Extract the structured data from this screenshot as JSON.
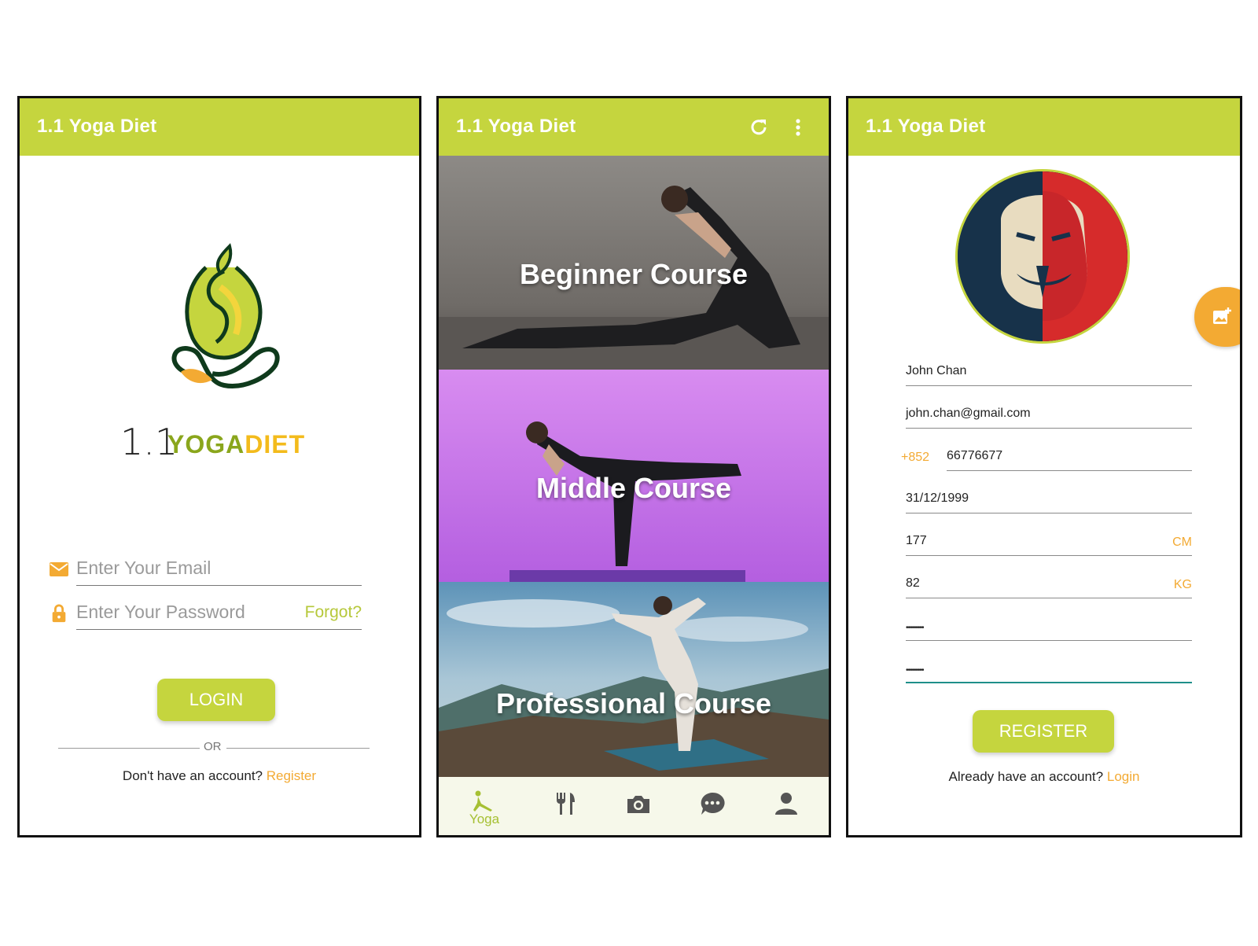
{
  "app": {
    "title": "1.1 Yoga Diet"
  },
  "login": {
    "logo": {
      "number": "1.1",
      "word_yoga": "YOGA",
      "word_diet": "DIET"
    },
    "email": {
      "placeholder": "Enter Your Email",
      "icon": "mail-icon"
    },
    "password": {
      "placeholder": "Enter Your Password",
      "icon": "lock-icon"
    },
    "forgot_label": "Forgot?",
    "login_label": "LOGIN",
    "or_label": "OR",
    "no_account_text": "Don't have an account?",
    "register_link": "Register"
  },
  "courses": {
    "actions": {
      "refresh_icon": "refresh-icon",
      "menu_icon": "more-vert-icon"
    },
    "items": [
      {
        "label": "Beginner Course"
      },
      {
        "label": "Middle Course"
      },
      {
        "label": "Professional Course"
      }
    ],
    "nav": [
      {
        "icon": "yoga-icon",
        "label": "Yoga",
        "active": true
      },
      {
        "icon": "restaurant-icon"
      },
      {
        "icon": "camera-icon"
      },
      {
        "icon": "chat-icon"
      },
      {
        "icon": "person-icon"
      }
    ]
  },
  "register": {
    "fab_icon": "add-photo-icon",
    "name": "John Chan",
    "email": "john.chan@gmail.com",
    "phone_prefix": "+852",
    "phone": "66776677",
    "birthday": "31/12/1999",
    "height": "177",
    "height_unit": "CM",
    "weight": "82",
    "weight_unit": "KG",
    "password_mask": "•••••••••",
    "confirm_mask": "•••••••••",
    "register_label": "REGISTER",
    "have_account_text": "Already have an account?",
    "login_link": "Login"
  },
  "colors": {
    "appbar": "#c5d53e",
    "accent_orange": "#f3aa33",
    "nav_bg": "#f6f8ea"
  }
}
